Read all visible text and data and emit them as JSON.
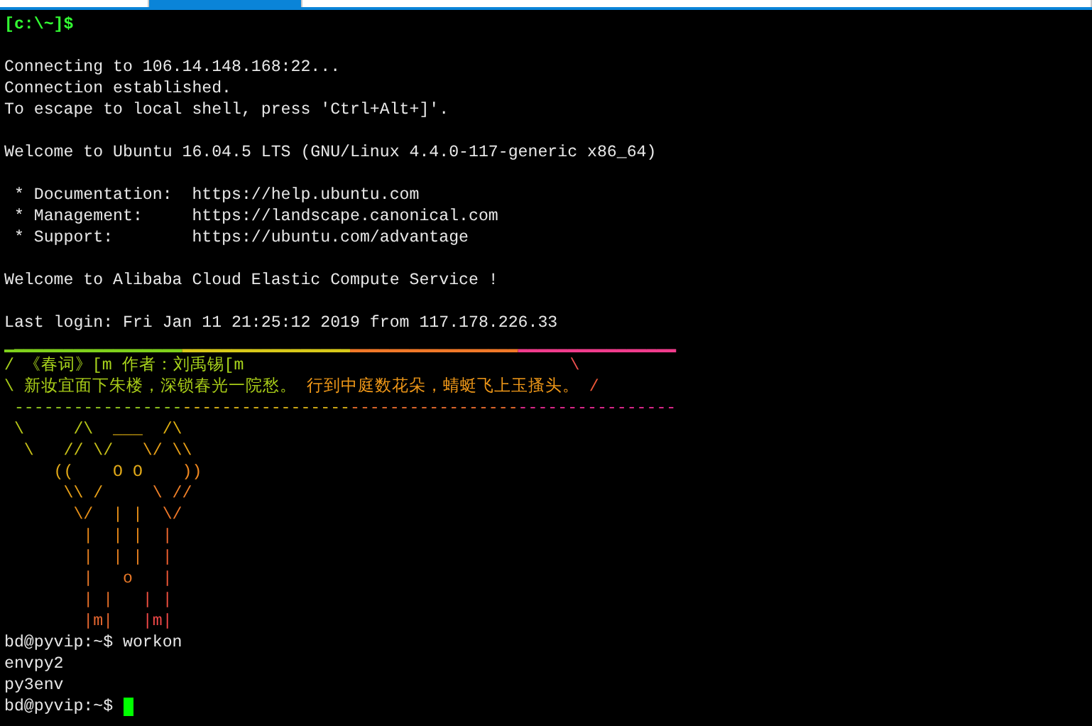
{
  "tabs": [
    {
      "selected": false
    },
    {
      "selected": true
    },
    {
      "selected": false
    }
  ],
  "terminal": {
    "lines": [
      {
        "kind": "local-prompt",
        "text": "[c:\\~]$"
      },
      {
        "kind": "blank"
      },
      {
        "kind": "text",
        "text": "Connecting to 106.14.148.168:22..."
      },
      {
        "kind": "text",
        "text": "Connection established."
      },
      {
        "kind": "text",
        "text": "To escape to local shell, press 'Ctrl+Alt+]'."
      },
      {
        "kind": "blank"
      },
      {
        "kind": "text",
        "text": "Welcome to Ubuntu 16.04.5 LTS (GNU/Linux 4.4.0-117-generic x86_64)"
      },
      {
        "kind": "blank"
      },
      {
        "kind": "text",
        "text": " * Documentation:  https://help.ubuntu.com"
      },
      {
        "kind": "text",
        "text": " * Management:     https://landscape.canonical.com"
      },
      {
        "kind": "text",
        "text": " * Support:        https://ubuntu.com/advantage"
      },
      {
        "kind": "blank"
      },
      {
        "kind": "text",
        "text": "Welcome to Alibaba Cloud Elastic Compute Service !"
      },
      {
        "kind": "blank"
      },
      {
        "kind": "text",
        "text": "Last login: Fri Jan 11 21:25:12 2019 from 117.178.226.33"
      },
      {
        "kind": "art-rule",
        "segments": [
          {
            "text": " _________________",
            "color": "#7fd01c"
          },
          {
            "text": "_________________",
            "color": "#d8c81a"
          },
          {
            "text": "_________________",
            "color": "#f07828"
          },
          {
            "text": "________________",
            "color": "#f03c8c"
          }
        ]
      },
      {
        "kind": "art",
        "segments": [
          {
            "text": "/ 《春词》[m 作者：刘禹锡[m                                 ",
            "color": "#a8d41c"
          },
          {
            "text": "\\",
            "color": "#f05050"
          }
        ]
      },
      {
        "kind": "art",
        "segments": [
          {
            "text": "\\ 新妆宜面下朱楼，深锁春光一院愁。",
            "color": "#a8cc18"
          },
          {
            "text": " 行到中庭数花朵，蜻蜓飞上玉搔头。",
            "color": "#f09818"
          },
          {
            "text": " /",
            "color": "#f05838"
          }
        ]
      },
      {
        "kind": "art",
        "segments": [
          {
            "text": " -----------------",
            "color": "#98d020"
          },
          {
            "text": "-----------------",
            "color": "#e0b818"
          },
          {
            "text": "-----------------",
            "color": "#f07030"
          },
          {
            "text": "----------------",
            "color": "#f02c98"
          }
        ]
      },
      {
        "kind": "art",
        "segments": [
          {
            "text": " \\     /\\  ",
            "color": "#b8c818"
          },
          {
            "text": "___  /\\",
            "color": "#e0b010"
          }
        ]
      },
      {
        "kind": "art",
        "segments": [
          {
            "text": "  \\   // \\/",
            "color": "#c8c018"
          },
          {
            "text": "   \\/ \\\\",
            "color": "#e8a018"
          }
        ]
      },
      {
        "kind": "art",
        "segments": [
          {
            "text": "     ((    O O",
            "color": "#e0a818"
          },
          {
            "text": "    ))",
            "color": "#f08820"
          }
        ]
      },
      {
        "kind": "art",
        "segments": [
          {
            "text": "      \\\\ /",
            "color": "#e8a018"
          },
          {
            "text": "     \\ //",
            "color": "#f08028"
          }
        ]
      },
      {
        "kind": "art",
        "segments": [
          {
            "text": "       \\/  | |",
            "color": "#e89018"
          },
          {
            "text": "  \\/",
            "color": "#f07828"
          }
        ]
      },
      {
        "kind": "art",
        "segments": [
          {
            "text": "        |  | |",
            "color": "#e88818"
          },
          {
            "text": "  |",
            "color": "#f06830"
          }
        ]
      },
      {
        "kind": "art",
        "segments": [
          {
            "text": "        |  | |",
            "color": "#e88020"
          },
          {
            "text": "  |",
            "color": "#f06030"
          }
        ]
      },
      {
        "kind": "art",
        "segments": [
          {
            "text": "        |   o",
            "color": "#e87828"
          },
          {
            "text": "   |",
            "color": "#f05838"
          }
        ]
      },
      {
        "kind": "art",
        "segments": [
          {
            "text": "        | |",
            "color": "#e87028"
          },
          {
            "text": "   | |",
            "color": "#f05040"
          }
        ]
      },
      {
        "kind": "art",
        "segments": [
          {
            "text": "        |m|",
            "color": "#e86830"
          },
          {
            "text": "   |m|",
            "color": "#f04848"
          }
        ]
      },
      {
        "kind": "text",
        "text": "bd@pyvip:~$ workon"
      },
      {
        "kind": "text",
        "text": "envpy2"
      },
      {
        "kind": "text",
        "text": "py3env"
      },
      {
        "kind": "prompt",
        "text": "bd@pyvip:~$ ",
        "cursor": true
      }
    ]
  }
}
